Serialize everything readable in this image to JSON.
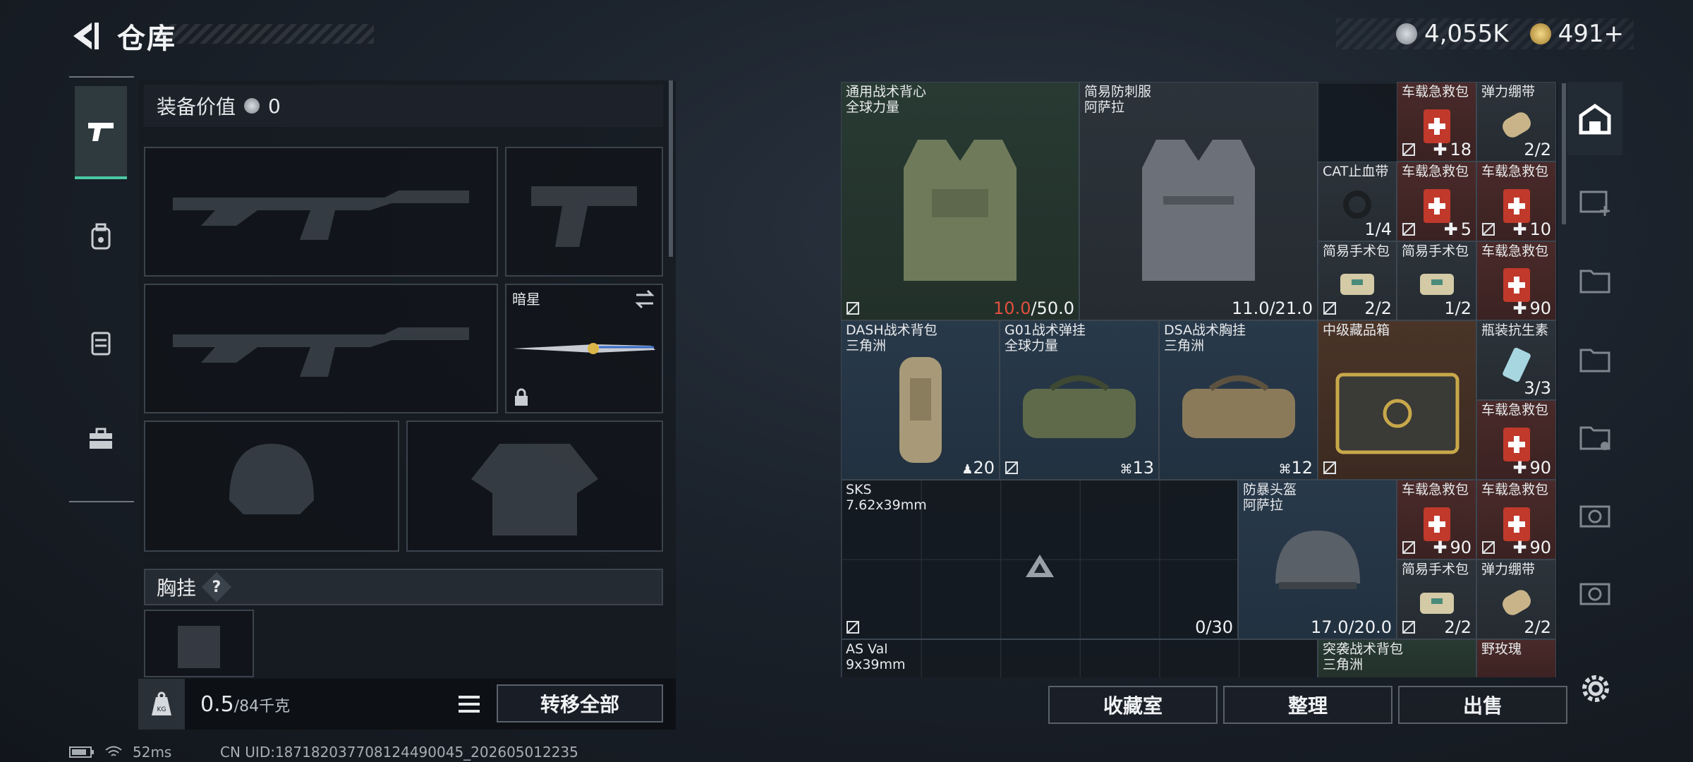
{
  "header": {
    "title": "仓库"
  },
  "currency": {
    "coins": "4,055K",
    "tokens": "491+"
  },
  "loadout": {
    "equip_value_label": "装备价值",
    "equip_value": "0",
    "melee_name": "暗星",
    "chest_label": "胸挂",
    "chest_hint": "?",
    "weight_value": "0.5",
    "weight_unit": "/84千克",
    "weight_icon_label": "KG",
    "transfer_all": "转移全部"
  },
  "stash": {
    "items": [
      {
        "name": "通用战术背心",
        "sub": "全球力量",
        "val_red": "10.0",
        "val": "/50.0"
      },
      {
        "name": "简易防刺服",
        "sub": "阿萨拉",
        "val": "11.0/21.0"
      },
      {
        "name": "车载急救包",
        "qty": "18"
      },
      {
        "name": "弹力绷带",
        "qty": "2/2"
      },
      {
        "name": "CAT止血带",
        "qty": "1/4"
      },
      {
        "name": "车载急救包",
        "qty": "5"
      },
      {
        "name": "车载急救包",
        "qty": "10"
      },
      {
        "name": "简易手术包",
        "qty": "2/2"
      },
      {
        "name": "简易手术包",
        "qty": "1/2"
      },
      {
        "name": "车载急救包",
        "qty": "90"
      },
      {
        "name": "DASH战术背包",
        "sub": "三角洲",
        "qty": "20"
      },
      {
        "name": "G01战术弹挂",
        "sub": "全球力量",
        "qty": "13"
      },
      {
        "name": "DSA战术胸挂",
        "sub": "三角洲",
        "qty": "12"
      },
      {
        "name": "中级藏品箱"
      },
      {
        "name": "瓶装抗生素",
        "qty": "3/3"
      },
      {
        "name": "车载急救包",
        "qty": "90"
      },
      {
        "name": "SKS",
        "sub": "7.62x39mm",
        "qty": "0/30"
      },
      {
        "name": "防暴头盔",
        "sub": "阿萨拉",
        "val": "17.0/20.0"
      },
      {
        "name": "车载急救包",
        "qty": "90"
      },
      {
        "name": "车载急救包",
        "qty": "90"
      },
      {
        "name": "简易手术包",
        "qty": "2/2"
      },
      {
        "name": "弹力绷带",
        "qty": "2/2"
      },
      {
        "name": "AS Val",
        "sub": "9x39mm"
      },
      {
        "name": "突袭战术背包",
        "sub": "三角洲"
      },
      {
        "name": "野玫瑰"
      }
    ]
  },
  "buttons": {
    "collection": "收藏室",
    "organize": "整理",
    "sell": "出售"
  },
  "status": {
    "ping": "52ms",
    "uid": "CN UID:18718203770812449004​5_202605012235"
  },
  "colors": {
    "accent": "#4bc7a2",
    "durability_red": "#e0503e"
  }
}
